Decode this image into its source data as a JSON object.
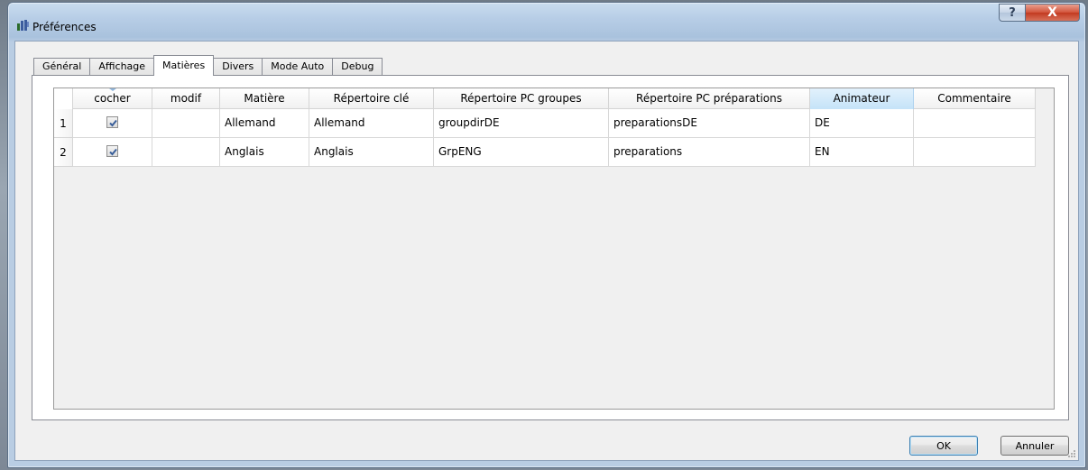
{
  "window": {
    "title": "Préférences",
    "help_glyph": "?",
    "close_glyph": "X"
  },
  "tabs": [
    {
      "label": "Général",
      "active": false
    },
    {
      "label": "Affichage",
      "active": false
    },
    {
      "label": "Matières",
      "active": true
    },
    {
      "label": "Divers",
      "active": false
    },
    {
      "label": "Mode Auto",
      "active": false
    },
    {
      "label": "Debug",
      "active": false
    }
  ],
  "grid": {
    "columns": [
      "cocher",
      "modif",
      "Matière",
      "Répertoire clé",
      "Répertoire PC groupes",
      "Répertoire PC préparations",
      "Animateur",
      "Commentaire"
    ],
    "selected_column": "Animateur",
    "rows": [
      {
        "num": "1",
        "cocher": true,
        "modif": "",
        "matiere": "Allemand",
        "repertoire_cle": "Allemand",
        "pc_groupes": "groupdirDE",
        "pc_preparations": "preparationsDE",
        "animateur": "DE",
        "commentaire": ""
      },
      {
        "num": "2",
        "cocher": true,
        "modif": "",
        "matiere": "Anglais",
        "repertoire_cle": "Anglais",
        "pc_groupes": "GrpENG",
        "pc_preparations": "preparations",
        "animateur": "EN",
        "commentaire": ""
      }
    ]
  },
  "buttons": {
    "ok": "OK",
    "cancel": "Annuler"
  },
  "colors": {
    "title_bar": "#b7cde6",
    "close_button": "#c23a20",
    "selected_header": "#c5e3f8",
    "ok_focus": "#3c7fb1"
  }
}
